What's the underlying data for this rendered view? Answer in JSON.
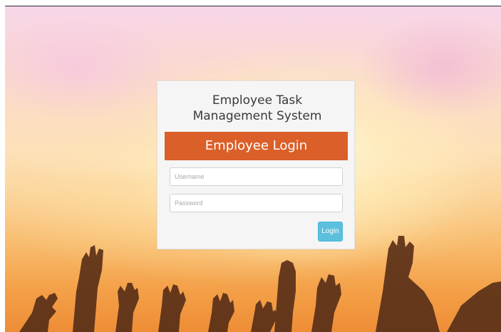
{
  "login_panel": {
    "title": "Employee Task Management System",
    "header": "Employee Login",
    "username": {
      "value": "",
      "placeholder": "Username"
    },
    "password": {
      "value": "",
      "placeholder": "Password"
    },
    "login_button": "Login"
  },
  "colors": {
    "header_bg": "#db5f28",
    "button_bg": "#5bc0de",
    "panel_bg": "#f5f5f5"
  }
}
